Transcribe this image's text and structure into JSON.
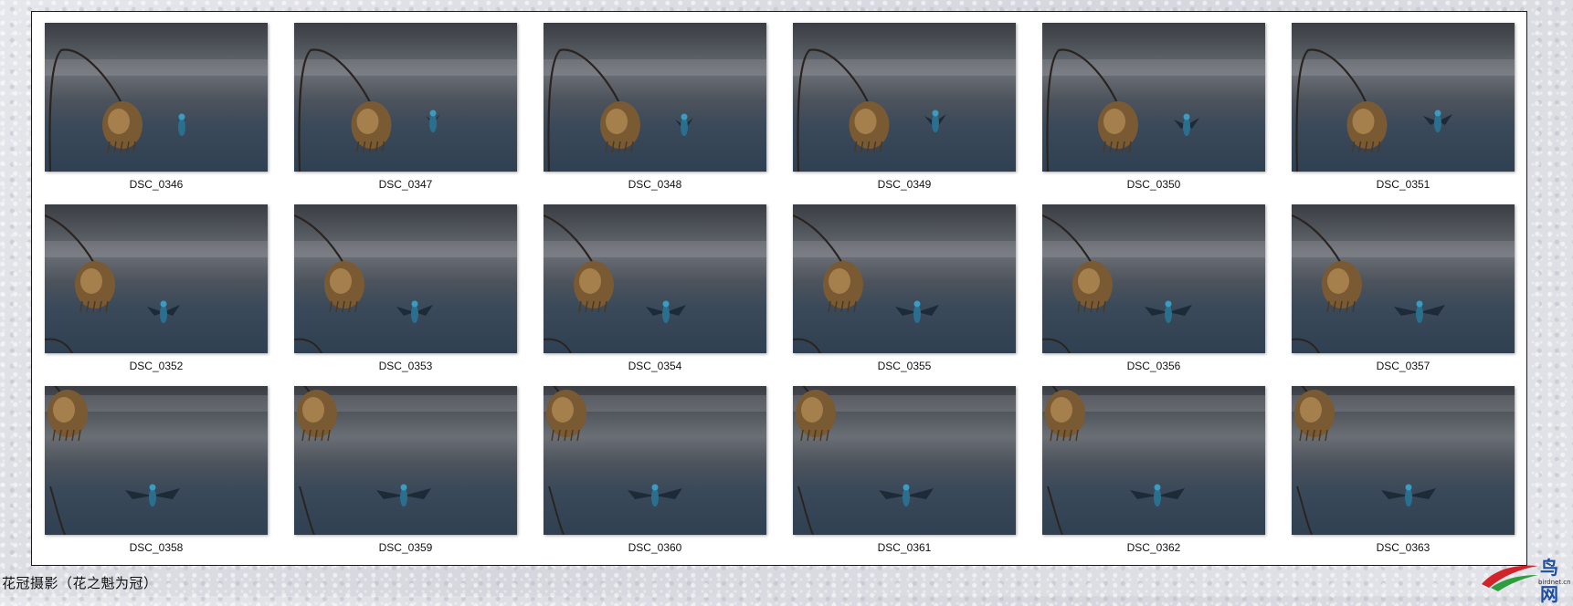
{
  "files": [
    {
      "name": "DSC_0346"
    },
    {
      "name": "DSC_0347"
    },
    {
      "name": "DSC_0348"
    },
    {
      "name": "DSC_0349"
    },
    {
      "name": "DSC_0350"
    },
    {
      "name": "DSC_0351"
    },
    {
      "name": "DSC_0352"
    },
    {
      "name": "DSC_0353"
    },
    {
      "name": "DSC_0354"
    },
    {
      "name": "DSC_0355"
    },
    {
      "name": "DSC_0356"
    },
    {
      "name": "DSC_0357"
    },
    {
      "name": "DSC_0358"
    },
    {
      "name": "DSC_0359"
    },
    {
      "name": "DSC_0360"
    },
    {
      "name": "DSC_0361"
    },
    {
      "name": "DSC_0362"
    },
    {
      "name": "DSC_0363"
    }
  ],
  "caption": "花冠摄影（花之魁为冠）",
  "watermark": {
    "title": "鸟网",
    "subtitle": "birdnet.cn"
  },
  "colors": {
    "accent": "#1d4e9e",
    "swoosh_red": "#d2232a",
    "swoosh_green": "#2e9d3e"
  }
}
